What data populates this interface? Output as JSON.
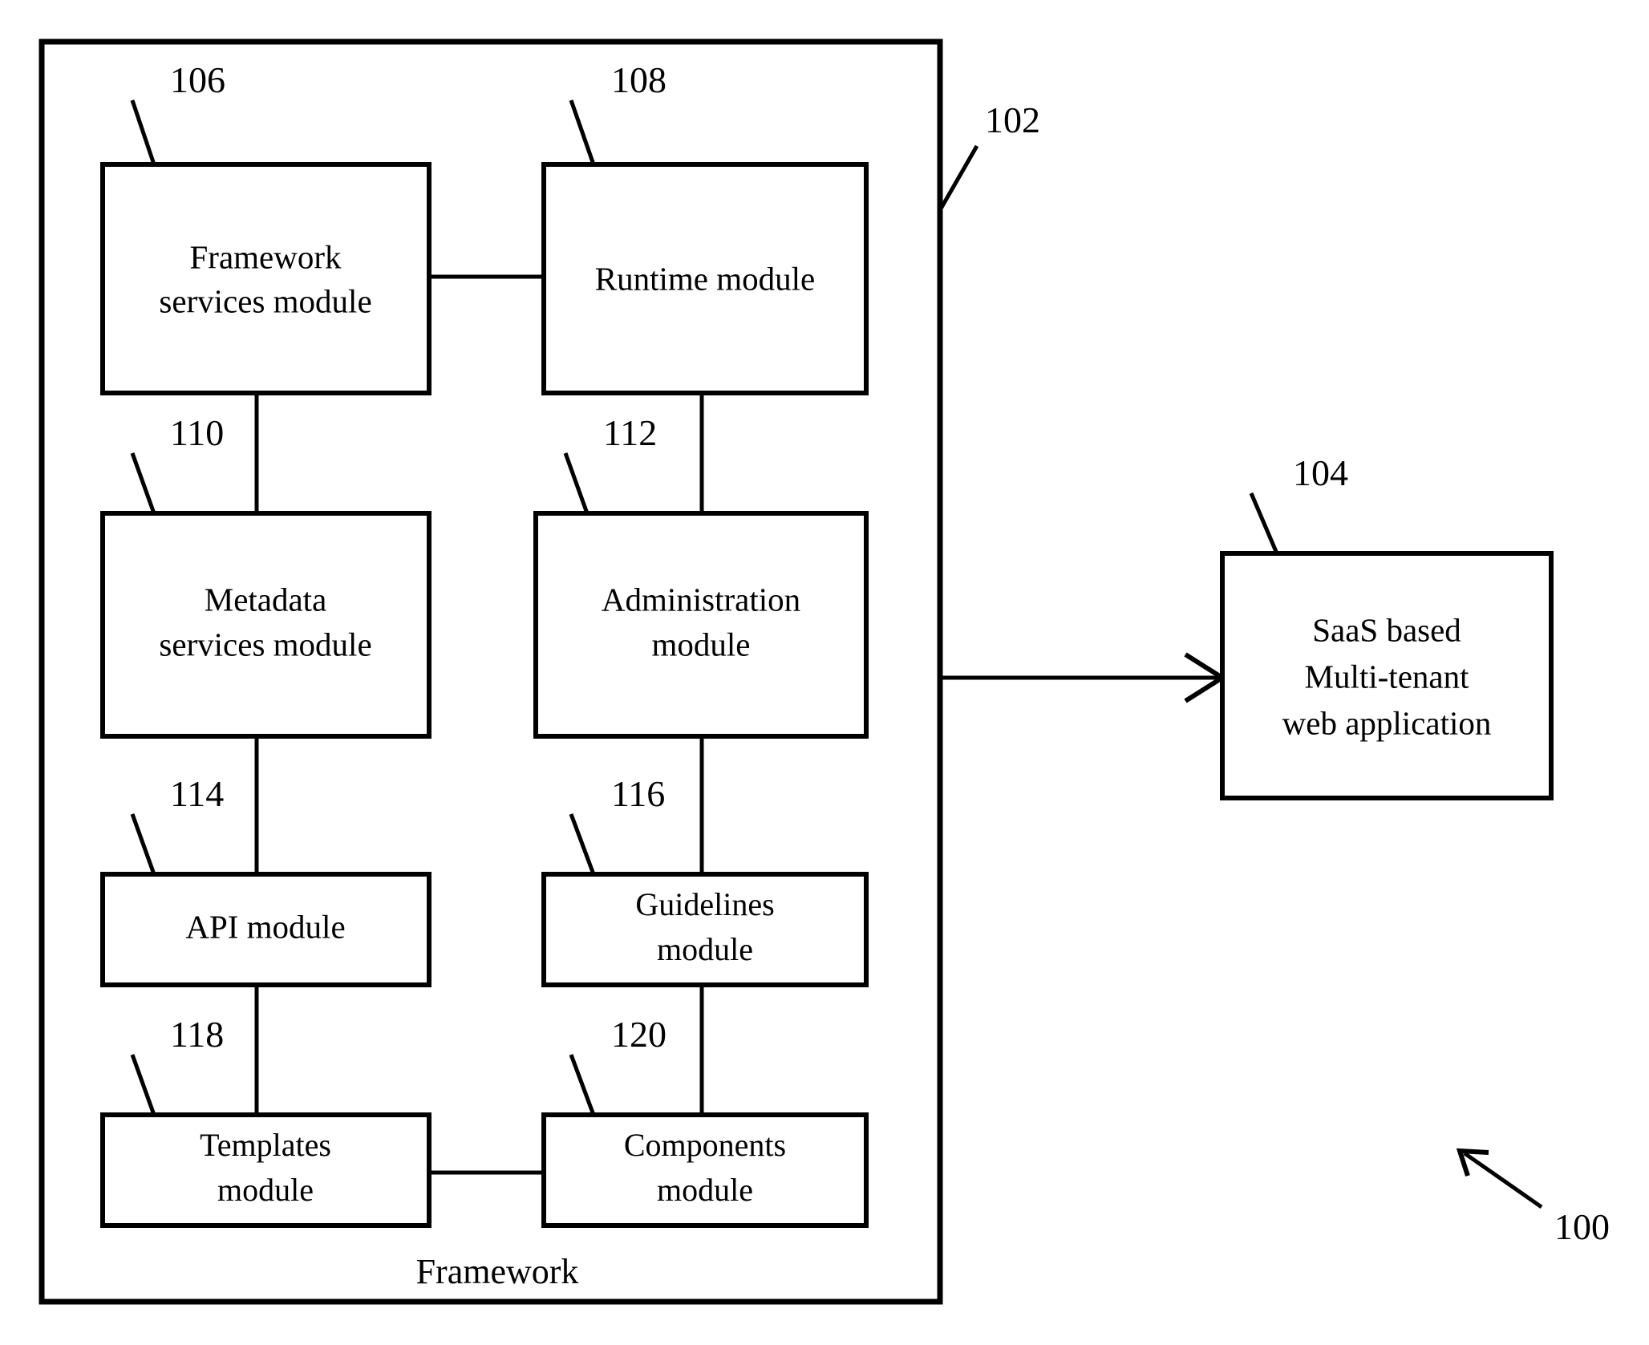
{
  "figure": {
    "reference_numeral": "100",
    "frame_caption": "Framework",
    "container_ref": "102"
  },
  "boxes": [
    {
      "id": "framework-services-module",
      "ref": "106",
      "lines": [
        "Framework",
        "services module"
      ]
    },
    {
      "id": "runtime-module",
      "ref": "108",
      "lines": [
        "Runtime module"
      ]
    },
    {
      "id": "metadata-services-module",
      "ref": "110",
      "lines": [
        "Metadata",
        "services module"
      ]
    },
    {
      "id": "administration-module",
      "ref": "112",
      "lines": [
        "Administration",
        "module"
      ]
    },
    {
      "id": "api-module",
      "ref": "114",
      "lines": [
        "API module"
      ]
    },
    {
      "id": "guidelines-module",
      "ref": "116",
      "lines": [
        "Guidelines",
        "module"
      ]
    },
    {
      "id": "templates-module",
      "ref": "118",
      "lines": [
        "Templates",
        "module"
      ]
    },
    {
      "id": "components-module",
      "ref": "120",
      "lines": [
        "Components",
        "module"
      ]
    },
    {
      "id": "saas-application",
      "ref": "104",
      "lines": [
        "SaaS based",
        "Multi-tenant",
        "web application"
      ]
    }
  ],
  "labels": {
    "ref_106": "106",
    "ref_108": "108",
    "ref_110": "110",
    "ref_112": "112",
    "ref_114": "114",
    "ref_116": "116",
    "ref_118": "118",
    "ref_120": "120",
    "ref_102": "102",
    "ref_104": "104",
    "ref_100": "100",
    "framework_services_l1": "Framework",
    "framework_services_l2": "services module",
    "runtime_l1": "Runtime module",
    "metadata_l1": "Metadata",
    "metadata_l2": "services module",
    "administration_l1": "Administration",
    "administration_l2": "module",
    "api_l1": "API module",
    "guidelines_l1": "Guidelines",
    "guidelines_l2": "module",
    "templates_l1": "Templates",
    "templates_l2": "module",
    "components_l1": "Components",
    "components_l2": "module",
    "saas_l1": "SaaS based",
    "saas_l2": "Multi-tenant",
    "saas_l3": "web application",
    "frame_caption": "Framework"
  },
  "colors": {
    "stroke": "#000000",
    "fill": "#ffffff",
    "background": "#ffffff"
  }
}
